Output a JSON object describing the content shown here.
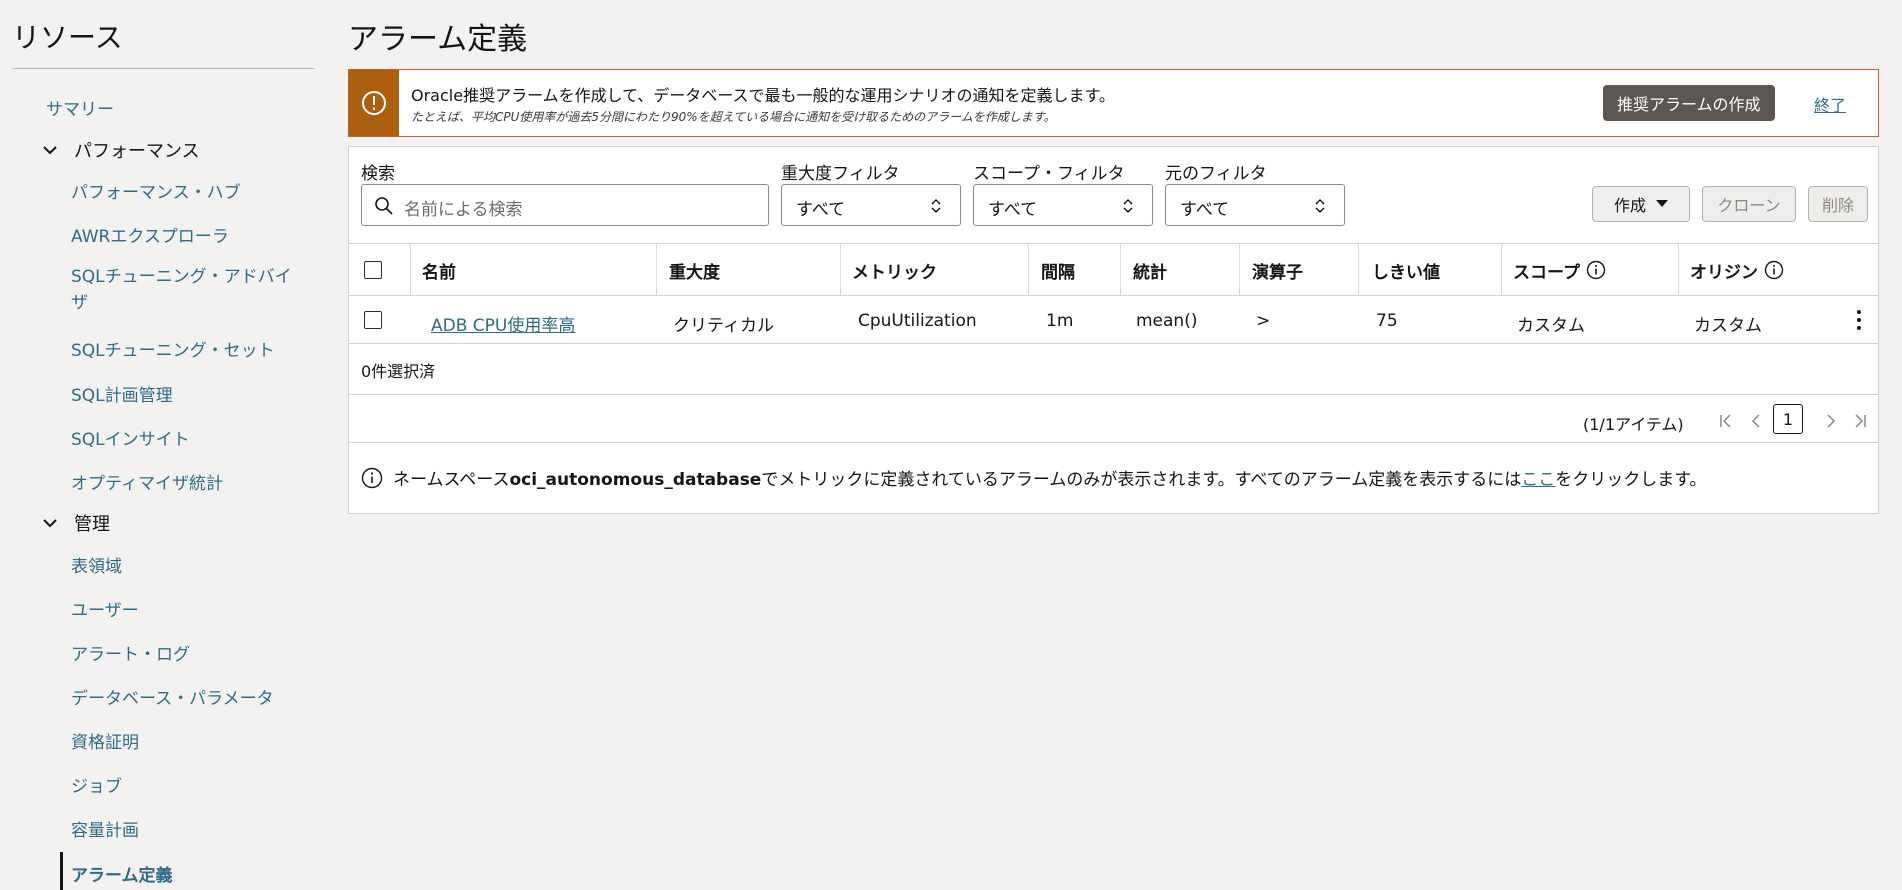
{
  "sidebar": {
    "title": "リソース",
    "summary": "サマリー",
    "group_performance": "パフォーマンス",
    "perf_items": [
      "パフォーマンス・ハブ",
      "AWRエクスプローラ",
      "SQLチューニング・アドバイザ",
      "SQLチューニング・セット",
      "SQL計画管理",
      "SQLインサイト",
      "オプティマイザ統計"
    ],
    "group_admin": "管理",
    "admin_items": [
      "表領域",
      "ユーザー",
      "アラート・ログ",
      "データベース・パラメータ",
      "資格証明",
      "ジョブ",
      "容量計画",
      "アラーム定義"
    ]
  },
  "page": {
    "title": "アラーム定義"
  },
  "banner": {
    "message": "Oracle推奨アラームを作成して、データベースで最も一般的な運用シナリオの通知を定義します。",
    "sub": "たとえば、平均CPU使用率が過去5分間にわたり90%を超えている場合に通知を受け取るためのアラームを作成します。",
    "create_button": "推奨アラームの作成",
    "dismiss_link": "終了",
    "accent": "#ad5f10"
  },
  "filters": {
    "search_label": "検索",
    "search_placeholder": "名前による検索",
    "severity_label": "重大度フィルタ",
    "severity_value": "すべて",
    "scope_label": "スコープ・フィルタ",
    "scope_value": "すべて",
    "origin_label": "元のフィルタ",
    "origin_value": "すべて"
  },
  "actions": {
    "create": "作成",
    "clone": "クローン",
    "delete": "削除"
  },
  "table": {
    "columns": [
      "名前",
      "重大度",
      "メトリック",
      "間隔",
      "統計",
      "演算子",
      "しきい値",
      "スコープ",
      "オリジン"
    ],
    "rows": [
      {
        "name": "ADB CPU使用率高",
        "severity": "クリティカル",
        "metric": "CpuUtilization",
        "interval": "1m",
        "statistic": "mean()",
        "operator": ">",
        "threshold": "75",
        "scope": "カスタム",
        "origin": "カスタム"
      }
    ]
  },
  "selection": "0件選択済",
  "pager": {
    "summary": "(1/1アイテム)",
    "page": "1"
  },
  "info": {
    "prefix": "ネームスペース",
    "namespace": "oci_autonomous_database",
    "middle": "でメトリックに定義されているアラームのみが表示されます。すべてのアラーム定義を表示するには",
    "link": "ここ",
    "suffix": "をクリックします。"
  }
}
